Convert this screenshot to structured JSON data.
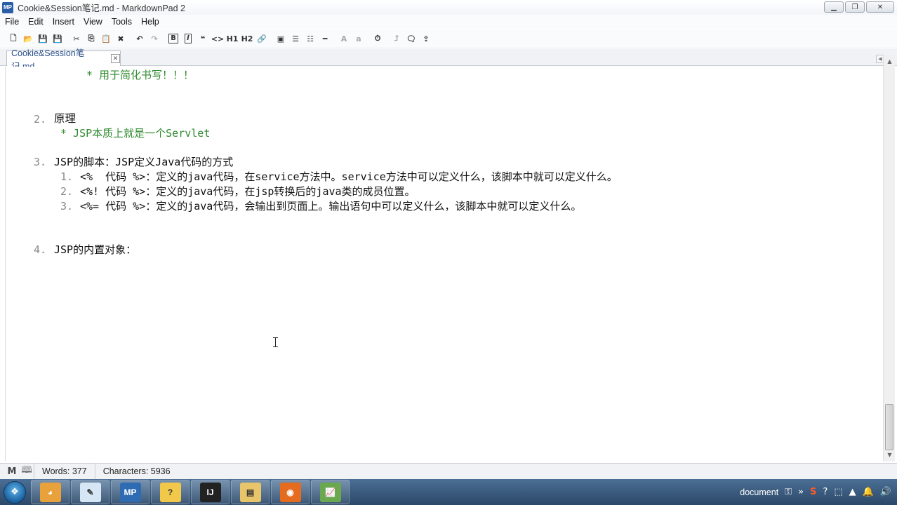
{
  "window": {
    "title": "Cookie&Session笔记.md - MarkdownPad 2",
    "app_badge": "MP",
    "controls": [
      "minimize-icon",
      "restore-icon",
      "close-icon"
    ]
  },
  "menu": {
    "items": [
      "File",
      "Edit",
      "Insert",
      "View",
      "Tools",
      "Help"
    ]
  },
  "toolbar": {
    "buttons": [
      {
        "name": "new-file-icon",
        "glyph": "🗋"
      },
      {
        "name": "open-folder-icon",
        "glyph": "📂"
      },
      {
        "name": "save-icon",
        "glyph": "💾"
      },
      {
        "name": "save-all-icon",
        "glyph": "💾"
      },
      {
        "name": "cut-icon",
        "glyph": "✂"
      },
      {
        "name": "copy-icon",
        "glyph": "⎘"
      },
      {
        "name": "paste-icon",
        "glyph": "📋"
      },
      {
        "name": "delete-icon",
        "glyph": "✖"
      },
      {
        "name": "undo-icon",
        "glyph": "↶"
      },
      {
        "name": "redo-icon",
        "glyph": "↷"
      },
      {
        "name": "bold-icon",
        "glyph": "B"
      },
      {
        "name": "italic-icon",
        "glyph": "I"
      },
      {
        "name": "quote-icon",
        "glyph": "❝"
      },
      {
        "name": "code-icon",
        "glyph": "<>"
      },
      {
        "name": "heading1-icon",
        "glyph": "H1"
      },
      {
        "name": "heading2-icon",
        "glyph": "H2"
      },
      {
        "name": "link-icon",
        "glyph": "🔗"
      },
      {
        "name": "image-icon",
        "glyph": "▣"
      },
      {
        "name": "bullet-list-icon",
        "glyph": "☰"
      },
      {
        "name": "numbered-list-icon",
        "glyph": "☷"
      },
      {
        "name": "horizontal-rule-icon",
        "glyph": "━"
      },
      {
        "name": "uppercase-icon",
        "glyph": "A"
      },
      {
        "name": "lowercase-icon",
        "glyph": "a"
      },
      {
        "name": "timestamp-icon",
        "glyph": "⏱"
      },
      {
        "name": "live-preview-icon",
        "glyph": "⮥"
      },
      {
        "name": "preview-window-icon",
        "glyph": "🗨"
      },
      {
        "name": "export-icon",
        "glyph": "⇪"
      }
    ]
  },
  "tab": {
    "label": "Cookie&Session笔记.md",
    "close": "✕"
  },
  "editor": {
    "lines": {
      "l1": "* 用于简化书写！！！",
      "l2_num": "2.",
      "l2_text": "原理",
      "l3": "* JSP本质上就是一个Servlet",
      "l4_num": "3.",
      "l4_text": "JSP的脚本：JSP定义Java代码的方式",
      "l5_num": "1.",
      "l5_text": "<%  代码 %>：定义的java代码，在service方法中。service方法中可以定义什么，该脚本中就可以定义什么。",
      "l6_num": "2.",
      "l6_text": "<%! 代码 %>：定义的java代码，在jsp转换后的java类的成员位置。",
      "l7_num": "3.",
      "l7_text": "<%= 代码 %>：定义的java代码，会输出到页面上。输出语句中可以定义什么，该脚本中就可以定义什么。",
      "l8_num": "4.",
      "l8_text": "JSP的内置对象："
    }
  },
  "status": {
    "words": "Words: 377",
    "characters": "Characters: 5936"
  },
  "taskbar": {
    "apps": [
      {
        "name": "taskbar-app-colors",
        "glyph": "◕"
      },
      {
        "name": "taskbar-app-notepad",
        "glyph": "✎"
      },
      {
        "name": "taskbar-app-markdownpad",
        "glyph": "MP"
      },
      {
        "name": "taskbar-app-help",
        "glyph": "?"
      },
      {
        "name": "taskbar-app-intellij",
        "glyph": "IJ"
      },
      {
        "name": "taskbar-app-explorer",
        "glyph": "▤"
      },
      {
        "name": "taskbar-app-firefox",
        "glyph": "◉"
      },
      {
        "name": "taskbar-app-chart",
        "glyph": "📈"
      }
    ],
    "tray_text": "document",
    "tray_icons": [
      "⚿",
      "»",
      "S",
      "?",
      "⬚",
      "▲",
      "🔔",
      "🔊"
    ]
  }
}
